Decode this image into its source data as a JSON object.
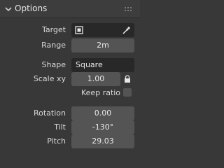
{
  "panel": {
    "title": "Options",
    "collapse_icon": "chevron-down-icon",
    "grip_icon": "drag-grip-icon"
  },
  "fields": {
    "target_label": "Target",
    "target_icon": "square-target-icon",
    "eyedropper_icon": "eyedropper-icon",
    "range_label": "Range",
    "range_value": "2m",
    "shape_label": "Shape",
    "shape_value": "Square",
    "scale_label": "Scale xy",
    "scale_value": "1.00",
    "lock_icon": "lock-icon",
    "keep_ratio_label": "Keep ratio",
    "keep_ratio_checked": false,
    "rotation_label": "Rotation",
    "rotation_value": "0.00",
    "tilt_label": "Tilt",
    "tilt_value": "-130°",
    "pitch_label": "Pitch",
    "pitch_value": "29.03"
  },
  "colors": {
    "panel_bg": "#383838",
    "field_bg": "#545454",
    "dark_field_bg": "#282828",
    "text": "#e0e0e0"
  }
}
